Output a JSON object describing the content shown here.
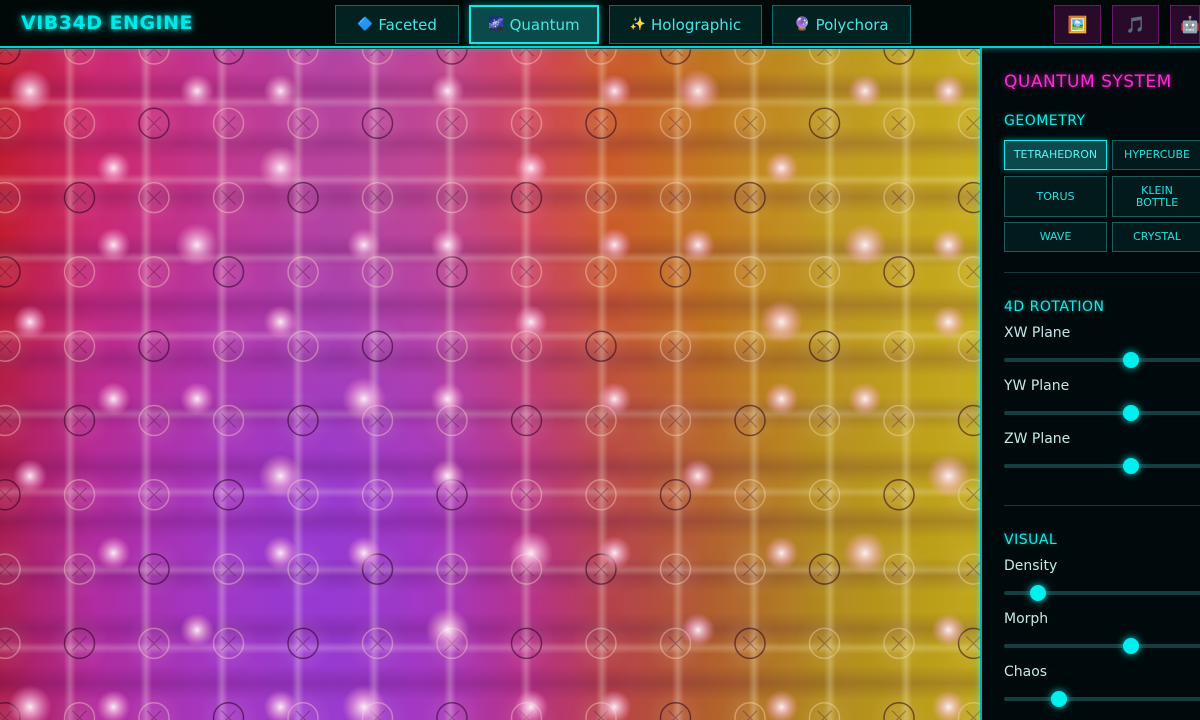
{
  "app": {
    "title": "VIB34D ENGINE"
  },
  "system_tabs": [
    {
      "icon": "🔷",
      "icon_name": "diamond-icon",
      "label": "Faceted",
      "active": false
    },
    {
      "icon": "🌌",
      "icon_name": "galaxy-icon",
      "label": "Quantum",
      "active": true
    },
    {
      "icon": "✨",
      "icon_name": "sparkles-icon",
      "label": "Holographic",
      "active": false
    },
    {
      "icon": "🔮",
      "icon_name": "crystal-ball-icon",
      "label": "Polychora",
      "active": false
    }
  ],
  "tool_buttons": [
    {
      "icon": "🖼️",
      "icon_name": "gallery-icon"
    },
    {
      "icon": "🎵",
      "icon_name": "music-icon"
    },
    {
      "icon": "🤖",
      "icon_name": "robot-icon"
    }
  ],
  "panel": {
    "title": "QUANTUM SYSTEM",
    "geometry": {
      "title": "GEOMETRY",
      "buttons": [
        {
          "label": "TETRAHEDRON",
          "active": true
        },
        {
          "label": "HYPERCUBE",
          "active": false
        },
        {
          "label": "TORUS",
          "active": false
        },
        {
          "label": "KLEIN BOTTLE",
          "active": false
        },
        {
          "label": "WAVE",
          "active": false
        },
        {
          "label": "CRYSTAL",
          "active": false
        }
      ]
    },
    "rotation": {
      "title": "4D ROTATION",
      "sliders": [
        {
          "label": "XW Plane",
          "value_fraction": 0.64
        },
        {
          "label": "YW Plane",
          "value_fraction": 0.64
        },
        {
          "label": "ZW Plane",
          "value_fraction": 0.64
        }
      ]
    },
    "visual": {
      "title": "VISUAL",
      "sliders": [
        {
          "label": "Density",
          "value_fraction": 0.17
        },
        {
          "label": "Morph",
          "value_fraction": 0.64
        },
        {
          "label": "Chaos",
          "value_fraction": 0.28
        }
      ]
    }
  },
  "colors": {
    "accent_cyan": "#00e8e8",
    "accent_magenta": "#ff2ad4"
  }
}
